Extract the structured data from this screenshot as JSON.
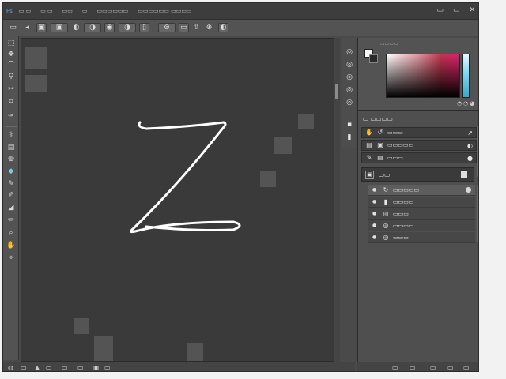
{
  "menubar": {
    "brand": "Ps",
    "items": [
      "▭ ▭",
      "▭ ▭",
      "▭▭",
      "▭",
      "▭▭▭▭▭▭",
      "▭▭▭▭▭▭ ▭▭▭▭"
    ],
    "window_controls": [
      "▭",
      "▭",
      "✕"
    ]
  },
  "options_bar": {
    "glyphs": [
      "▭",
      "◂",
      "▣",
      "▣",
      "◐",
      "◑",
      "◉",
      "◑",
      "▯",
      "⊚",
      "▭",
      "⇧",
      "⊕",
      "◐"
    ]
  },
  "tools": {
    "glyphs": [
      "⬚",
      "✥",
      "⌒",
      "⚲",
      "✂",
      "⌗",
      "✑",
      "⚕",
      "▤",
      "◍",
      "◆",
      "✎",
      "✐",
      "◢",
      "✏",
      "⌕",
      "✋",
      "⌖"
    ]
  },
  "mini_strip": {
    "glyphs": [
      "◎",
      "◎",
      "◎",
      "◎",
      "◎",
      "▪",
      "▮"
    ]
  },
  "panels": {
    "color_tab": "▭▭▭▭",
    "color_footer": [
      "◔",
      "◔",
      "◕"
    ],
    "group1": {
      "title": "▭ ▭▭▭▭",
      "rows": [
        {
          "icon": "✋",
          "icon2": "↺",
          "label": "▭▭▭",
          "right": "↗"
        },
        {
          "icon": "▤",
          "icon2": "▣",
          "label": "▭▭▭▭▭",
          "right": "◐"
        },
        {
          "icon": "✎",
          "icon2": "▤",
          "label": "▭▭▭",
          "right": "●"
        }
      ]
    },
    "layers": {
      "title": "▭▭",
      "icon": "▣",
      "rows": [
        {
          "icon": "↻",
          "label": "▭▭▭▭▭",
          "selected": true
        },
        {
          "icon": "▮",
          "label": "▭▭▭▭",
          "selected": false
        },
        {
          "icon": "◎",
          "label": "▭▭▭",
          "selected": false
        },
        {
          "icon": "◎",
          "label": "▭▭▭▭",
          "selected": false
        },
        {
          "icon": "◎",
          "label": "▭▭▭",
          "selected": false
        }
      ]
    }
  },
  "status_left": [
    "◍",
    "▭",
    "▲",
    "▭",
    "▭",
    "▭",
    "▣",
    "▭"
  ],
  "status_right": [
    "▭",
    "▭",
    "▭",
    "▭",
    "▭"
  ],
  "colors": {
    "chrome": "#4a4a4a",
    "canvas": "#3a3a3a",
    "accent": "#7ad0d8"
  }
}
